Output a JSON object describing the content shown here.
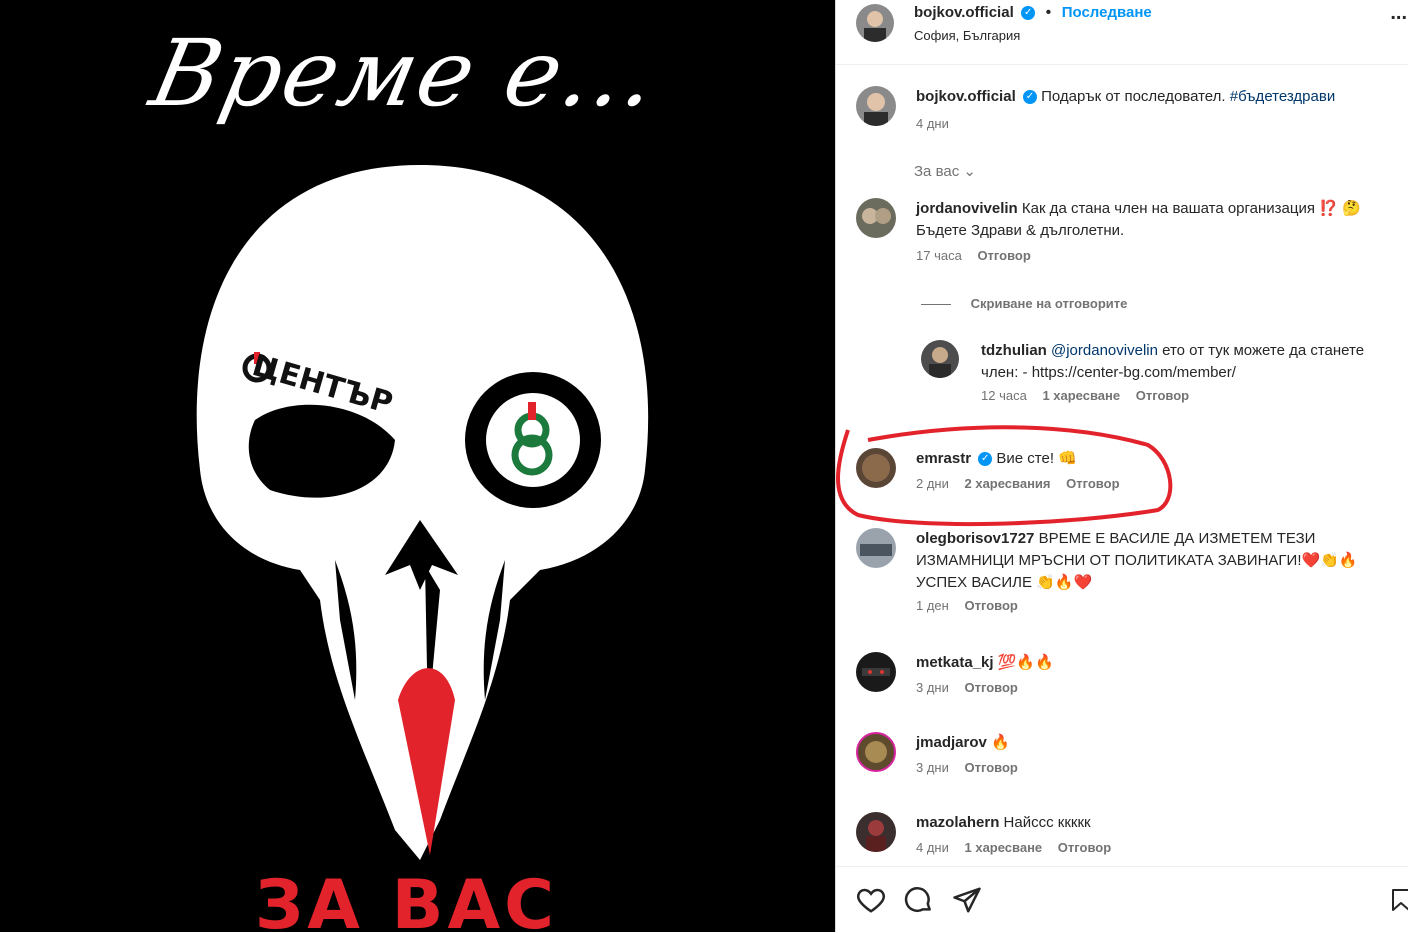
{
  "post_image": {
    "script_title": "Време е...",
    "logo_text": "ЦЕНТЪР",
    "logo_number": "8",
    "bottom_text": "ЗА ВАС"
  },
  "header": {
    "username": "bojkov.official",
    "separator": "•",
    "follow_label": "Последване",
    "location": "София, България",
    "more_label": "..."
  },
  "caption": {
    "username": "bojkov.official",
    "text": "Подарък от последовател.",
    "hashtag": "#бъдетездрави",
    "time": "4 дни"
  },
  "filter": {
    "label": "За вас"
  },
  "comments": [
    {
      "username": "jordanovivelin",
      "text": "Как да стана член на вашата организация ⁉️ 🤔 Бъдете Здрави & дълголетни.",
      "time": "17 часа",
      "reply": "Отговор",
      "hide_replies": "Скриване на отговорите",
      "replies": [
        {
          "username": "tdzhulian",
          "mention": "@jordanovivelin",
          "text": "ето от тук можете да станете член: - https://center-bg.com/member/",
          "time": "12 часа",
          "likes": "1 харесване",
          "reply": "Отговор"
        }
      ]
    },
    {
      "username": "emrastr",
      "text": "Вие сте! 👊",
      "time": "2 дни",
      "likes": "2 харесвания",
      "reply": "Отговор"
    },
    {
      "username": "olegborisov1727",
      "text": "ВРЕМЕ Е ВАСИЛЕ ДА ИЗМЕТЕМ ТЕЗИ ИЗМАМНИЦИ МРЪСНИ ОТ ПОЛИТИКАТА ЗАВИНАГИ!❤️👏🔥УСПЕХ ВАСИЛЕ 👏🔥❤️",
      "time": "1 ден",
      "reply": "Отговор"
    },
    {
      "username": "metkata_kj",
      "text": "💯🔥🔥",
      "time": "3 дни",
      "reply": "Отговор"
    },
    {
      "username": "jmadjarov",
      "text": "🔥",
      "time": "3 дни",
      "reply": "Отговор"
    },
    {
      "username": "mazolahern",
      "text": "Найссс ккккк",
      "time": "4 дни",
      "likes": "1 харесване",
      "reply": "Отговор"
    }
  ],
  "actions": [
    "heart-icon",
    "comment-icon",
    "share-icon",
    "save-icon"
  ],
  "colors": {
    "accent": "#0095f6",
    "annotation": "#e3232b",
    "logo_green": "#1b7a3c"
  }
}
